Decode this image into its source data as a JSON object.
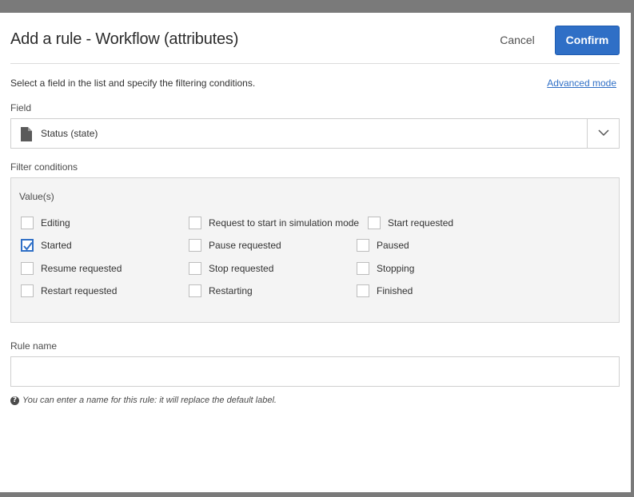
{
  "dialog": {
    "title": "Add a rule - Workflow (attributes)",
    "cancel_label": "Cancel",
    "confirm_label": "Confirm",
    "intro": "Select a field in the list and specify the filtering conditions.",
    "advanced_mode_label": "Advanced mode"
  },
  "field": {
    "label": "Field",
    "value": "Status (state)",
    "icon": "document-icon"
  },
  "filter": {
    "label": "Filter conditions",
    "values_label": "Value(s)",
    "options": [
      {
        "label": "Editing",
        "checked": false
      },
      {
        "label": "Request to start in simulation mode",
        "checked": false
      },
      {
        "label": "Start requested",
        "checked": false
      },
      {
        "label": "Started",
        "checked": true
      },
      {
        "label": "Pause requested",
        "checked": false
      },
      {
        "label": "Paused",
        "checked": false
      },
      {
        "label": "Resume requested",
        "checked": false
      },
      {
        "label": "Stop requested",
        "checked": false
      },
      {
        "label": "Stopping",
        "checked": false
      },
      {
        "label": "Restart requested",
        "checked": false
      },
      {
        "label": "Restarting",
        "checked": false
      },
      {
        "label": "Finished",
        "checked": false
      }
    ]
  },
  "rule_name": {
    "label": "Rule name",
    "value": "",
    "help": "You can enter a name for this rule: it will replace the default label."
  },
  "colors": {
    "accent": "#2f6fc6",
    "overlay": "#7a7a7a"
  }
}
